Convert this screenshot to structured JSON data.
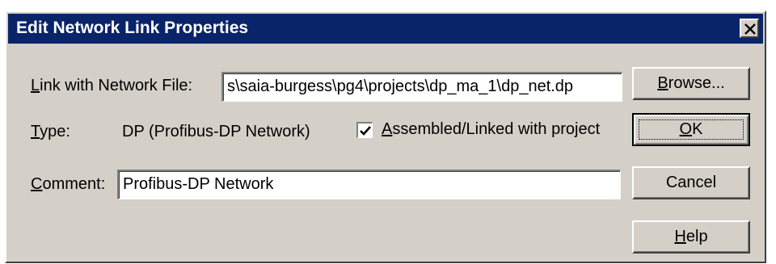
{
  "dialog": {
    "title": "Edit Network Link Properties"
  },
  "form": {
    "link_label": "ink with Network File:",
    "link_mnemonic": "L",
    "link_value": "s\\saia-burgess\\pg4\\projects\\dp_ma_1\\dp_net.dp",
    "type_label": "ype:",
    "type_mnemonic": "T",
    "type_value": "DP (Profibus-DP Network)",
    "assembled_label_rest": "ssembled/Linked with project",
    "assembled_mnemonic": "A",
    "assembled_checked": true,
    "comment_label": "omment:",
    "comment_mnemonic": "C",
    "comment_value": "Profibus-DP Network"
  },
  "buttons": {
    "browse_mnemonic": "B",
    "browse_rest": "rowse...",
    "ok_mnemonic": "O",
    "ok_rest": "K",
    "cancel": "Cancel",
    "help_mnemonic": "H",
    "help_rest": "elp"
  }
}
